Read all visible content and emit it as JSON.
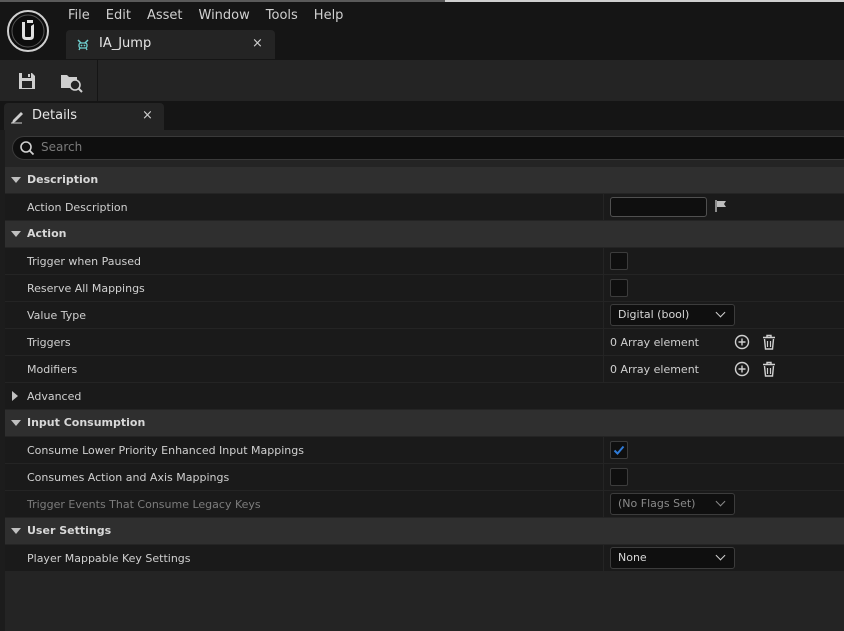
{
  "menu": [
    "File",
    "Edit",
    "Asset",
    "Window",
    "Tools",
    "Help"
  ],
  "asset_tab": {
    "label": "IA_Jump",
    "close": "×"
  },
  "details_tab": {
    "label": "Details",
    "close": "×"
  },
  "search": {
    "placeholder": "Search"
  },
  "colors": {
    "accent_check": "#2f7bd8",
    "panel_bg": "#242424",
    "row_bg": "#1a1a1a",
    "category_bg": "#2f2f2f"
  },
  "icons": [
    "unreal-logo-icon",
    "input-action-icon",
    "save-icon",
    "browse-icon",
    "pencil-icon",
    "search-icon",
    "flag-icon",
    "add-icon",
    "trash-icon",
    "chevron-down-icon",
    "checkmark-icon"
  ],
  "sections": {
    "description": {
      "title": "Description",
      "action_description": {
        "label": "Action Description",
        "value": ""
      }
    },
    "action": {
      "title": "Action",
      "trigger_when_paused": {
        "label": "Trigger when Paused",
        "checked": false
      },
      "reserve_all_mappings": {
        "label": "Reserve All Mappings",
        "checked": false
      },
      "value_type": {
        "label": "Value Type",
        "value": "Digital (bool)"
      },
      "triggers": {
        "label": "Triggers",
        "value": "0 Array element"
      },
      "modifiers": {
        "label": "Modifiers",
        "value": "0 Array element"
      },
      "advanced": {
        "label": "Advanced"
      }
    },
    "input_consumption": {
      "title": "Input Consumption",
      "consume_lower_priority": {
        "label": "Consume Lower Priority Enhanced Input Mappings",
        "checked": true
      },
      "consumes_action_axis": {
        "label": "Consumes Action and Axis Mappings",
        "checked": false
      },
      "trigger_events_legacy": {
        "label": "Trigger Events That Consume Legacy Keys",
        "value": "(No Flags Set)"
      }
    },
    "user_settings": {
      "title": "User Settings",
      "player_mappable": {
        "label": "Player Mappable Key Settings",
        "value": "None"
      }
    }
  }
}
